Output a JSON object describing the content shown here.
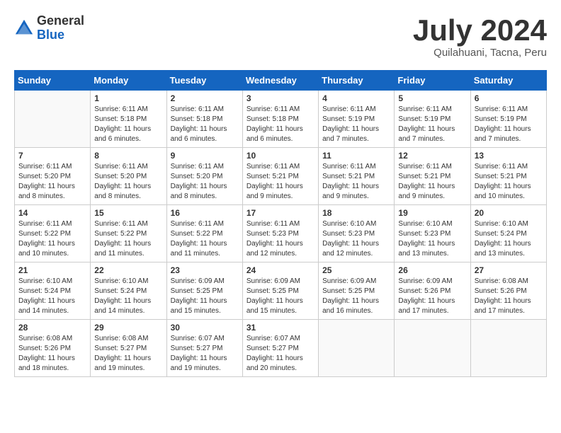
{
  "header": {
    "logo_general": "General",
    "logo_blue": "Blue",
    "month_title": "July 2024",
    "location": "Quilahuani, Tacna, Peru"
  },
  "weekdays": [
    "Sunday",
    "Monday",
    "Tuesday",
    "Wednesday",
    "Thursday",
    "Friday",
    "Saturday"
  ],
  "weeks": [
    [
      {
        "day": "",
        "info": ""
      },
      {
        "day": "1",
        "info": "Sunrise: 6:11 AM\nSunset: 5:18 PM\nDaylight: 11 hours\nand 6 minutes."
      },
      {
        "day": "2",
        "info": "Sunrise: 6:11 AM\nSunset: 5:18 PM\nDaylight: 11 hours\nand 6 minutes."
      },
      {
        "day": "3",
        "info": "Sunrise: 6:11 AM\nSunset: 5:18 PM\nDaylight: 11 hours\nand 6 minutes."
      },
      {
        "day": "4",
        "info": "Sunrise: 6:11 AM\nSunset: 5:19 PM\nDaylight: 11 hours\nand 7 minutes."
      },
      {
        "day": "5",
        "info": "Sunrise: 6:11 AM\nSunset: 5:19 PM\nDaylight: 11 hours\nand 7 minutes."
      },
      {
        "day": "6",
        "info": "Sunrise: 6:11 AM\nSunset: 5:19 PM\nDaylight: 11 hours\nand 7 minutes."
      }
    ],
    [
      {
        "day": "7",
        "info": "Sunrise: 6:11 AM\nSunset: 5:20 PM\nDaylight: 11 hours\nand 8 minutes."
      },
      {
        "day": "8",
        "info": "Sunrise: 6:11 AM\nSunset: 5:20 PM\nDaylight: 11 hours\nand 8 minutes."
      },
      {
        "day": "9",
        "info": "Sunrise: 6:11 AM\nSunset: 5:20 PM\nDaylight: 11 hours\nand 8 minutes."
      },
      {
        "day": "10",
        "info": "Sunrise: 6:11 AM\nSunset: 5:21 PM\nDaylight: 11 hours\nand 9 minutes."
      },
      {
        "day": "11",
        "info": "Sunrise: 6:11 AM\nSunset: 5:21 PM\nDaylight: 11 hours\nand 9 minutes."
      },
      {
        "day": "12",
        "info": "Sunrise: 6:11 AM\nSunset: 5:21 PM\nDaylight: 11 hours\nand 9 minutes."
      },
      {
        "day": "13",
        "info": "Sunrise: 6:11 AM\nSunset: 5:21 PM\nDaylight: 11 hours\nand 10 minutes."
      }
    ],
    [
      {
        "day": "14",
        "info": "Sunrise: 6:11 AM\nSunset: 5:22 PM\nDaylight: 11 hours\nand 10 minutes."
      },
      {
        "day": "15",
        "info": "Sunrise: 6:11 AM\nSunset: 5:22 PM\nDaylight: 11 hours\nand 11 minutes."
      },
      {
        "day": "16",
        "info": "Sunrise: 6:11 AM\nSunset: 5:22 PM\nDaylight: 11 hours\nand 11 minutes."
      },
      {
        "day": "17",
        "info": "Sunrise: 6:11 AM\nSunset: 5:23 PM\nDaylight: 11 hours\nand 12 minutes."
      },
      {
        "day": "18",
        "info": "Sunrise: 6:10 AM\nSunset: 5:23 PM\nDaylight: 11 hours\nand 12 minutes."
      },
      {
        "day": "19",
        "info": "Sunrise: 6:10 AM\nSunset: 5:23 PM\nDaylight: 11 hours\nand 13 minutes."
      },
      {
        "day": "20",
        "info": "Sunrise: 6:10 AM\nSunset: 5:24 PM\nDaylight: 11 hours\nand 13 minutes."
      }
    ],
    [
      {
        "day": "21",
        "info": "Sunrise: 6:10 AM\nSunset: 5:24 PM\nDaylight: 11 hours\nand 14 minutes."
      },
      {
        "day": "22",
        "info": "Sunrise: 6:10 AM\nSunset: 5:24 PM\nDaylight: 11 hours\nand 14 minutes."
      },
      {
        "day": "23",
        "info": "Sunrise: 6:09 AM\nSunset: 5:25 PM\nDaylight: 11 hours\nand 15 minutes."
      },
      {
        "day": "24",
        "info": "Sunrise: 6:09 AM\nSunset: 5:25 PM\nDaylight: 11 hours\nand 15 minutes."
      },
      {
        "day": "25",
        "info": "Sunrise: 6:09 AM\nSunset: 5:25 PM\nDaylight: 11 hours\nand 16 minutes."
      },
      {
        "day": "26",
        "info": "Sunrise: 6:09 AM\nSunset: 5:26 PM\nDaylight: 11 hours\nand 17 minutes."
      },
      {
        "day": "27",
        "info": "Sunrise: 6:08 AM\nSunset: 5:26 PM\nDaylight: 11 hours\nand 17 minutes."
      }
    ],
    [
      {
        "day": "28",
        "info": "Sunrise: 6:08 AM\nSunset: 5:26 PM\nDaylight: 11 hours\nand 18 minutes."
      },
      {
        "day": "29",
        "info": "Sunrise: 6:08 AM\nSunset: 5:27 PM\nDaylight: 11 hours\nand 19 minutes."
      },
      {
        "day": "30",
        "info": "Sunrise: 6:07 AM\nSunset: 5:27 PM\nDaylight: 11 hours\nand 19 minutes."
      },
      {
        "day": "31",
        "info": "Sunrise: 6:07 AM\nSunset: 5:27 PM\nDaylight: 11 hours\nand 20 minutes."
      },
      {
        "day": "",
        "info": ""
      },
      {
        "day": "",
        "info": ""
      },
      {
        "day": "",
        "info": ""
      }
    ]
  ]
}
